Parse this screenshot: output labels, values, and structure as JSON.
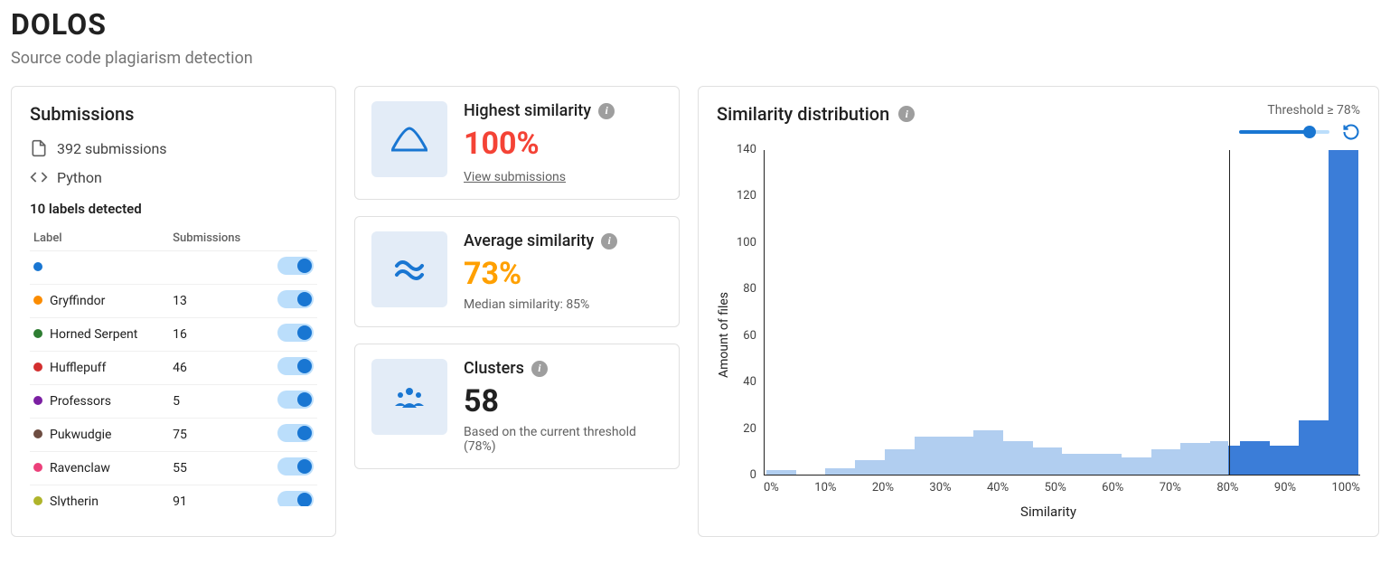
{
  "header": {
    "title": "DOLOS",
    "subtitle": "Source code plagiarism detection"
  },
  "submissions": {
    "title": "Submissions",
    "count_text": "392 submissions",
    "language": "Python",
    "labels_detected": "10 labels detected",
    "col_label": "Label",
    "col_submissions": "Submissions",
    "labels": [
      {
        "name": "",
        "count": "",
        "color": "#1976d2"
      },
      {
        "name": "Gryffindor",
        "count": "13",
        "color": "#fb8c00"
      },
      {
        "name": "Horned Serpent",
        "count": "16",
        "color": "#2e7d32"
      },
      {
        "name": "Hufflepuff",
        "count": "46",
        "color": "#d32f2f"
      },
      {
        "name": "Professors",
        "count": "5",
        "color": "#7b1fa2"
      },
      {
        "name": "Pukwudgie",
        "count": "75",
        "color": "#6d4c41"
      },
      {
        "name": "Ravenclaw",
        "count": "55",
        "color": "#ec407a"
      },
      {
        "name": "Slytherin",
        "count": "91",
        "color": "#afb42b"
      }
    ]
  },
  "stats": {
    "highest": {
      "label": "Highest similarity",
      "value": "100%",
      "link": "View submissions"
    },
    "average": {
      "label": "Average similarity",
      "value": "73%",
      "sub": "Median similarity: 85%"
    },
    "clusters": {
      "label": "Clusters",
      "value": "58",
      "sub": "Based on the current threshold (78%)"
    }
  },
  "dist": {
    "title": "Similarity distribution",
    "threshold_label": "Threshold ≥ 78%",
    "threshold_pct": 78,
    "ylabel": "Amount of files",
    "xlabel": "Similarity"
  },
  "chart_data": {
    "type": "bar",
    "title": "Similarity distribution",
    "xlabel": "Similarity",
    "ylabel": "Amount of files",
    "ylim": [
      0,
      155
    ],
    "y_ticks": [
      0,
      20,
      40,
      60,
      80,
      100,
      120,
      140
    ],
    "x_ticks": [
      "0%",
      "10%",
      "20%",
      "30%",
      "40%",
      "50%",
      "60%",
      "70%",
      "80%",
      "90%",
      "100%"
    ],
    "threshold": 78,
    "series": [
      {
        "name": "below-threshold",
        "color": "#b1cef0",
        "bins": [
          {
            "x_start": 0,
            "x_end": 5,
            "value": 2
          },
          {
            "x_start": 5,
            "x_end": 10,
            "value": 0
          },
          {
            "x_start": 10,
            "x_end": 15,
            "value": 3
          },
          {
            "x_start": 15,
            "x_end": 20,
            "value": 7
          },
          {
            "x_start": 20,
            "x_end": 25,
            "value": 12
          },
          {
            "x_start": 25,
            "x_end": 30,
            "value": 18
          },
          {
            "x_start": 30,
            "x_end": 35,
            "value": 18
          },
          {
            "x_start": 35,
            "x_end": 40,
            "value": 21
          },
          {
            "x_start": 40,
            "x_end": 45,
            "value": 16
          },
          {
            "x_start": 45,
            "x_end": 50,
            "value": 13
          },
          {
            "x_start": 50,
            "x_end": 55,
            "value": 10
          },
          {
            "x_start": 55,
            "x_end": 60,
            "value": 10
          },
          {
            "x_start": 60,
            "x_end": 65,
            "value": 8
          },
          {
            "x_start": 65,
            "x_end": 70,
            "value": 12
          },
          {
            "x_start": 70,
            "x_end": 75,
            "value": 15
          },
          {
            "x_start": 75,
            "x_end": 78,
            "value": 16
          }
        ]
      },
      {
        "name": "above-threshold",
        "color": "#3b7dd8",
        "bins": [
          {
            "x_start": 78,
            "x_end": 80,
            "value": 14
          },
          {
            "x_start": 80,
            "x_end": 85,
            "value": 16
          },
          {
            "x_start": 85,
            "x_end": 90,
            "value": 14
          },
          {
            "x_start": 90,
            "x_end": 95,
            "value": 26
          },
          {
            "x_start": 95,
            "x_end": 100,
            "value": 155
          }
        ]
      }
    ]
  }
}
